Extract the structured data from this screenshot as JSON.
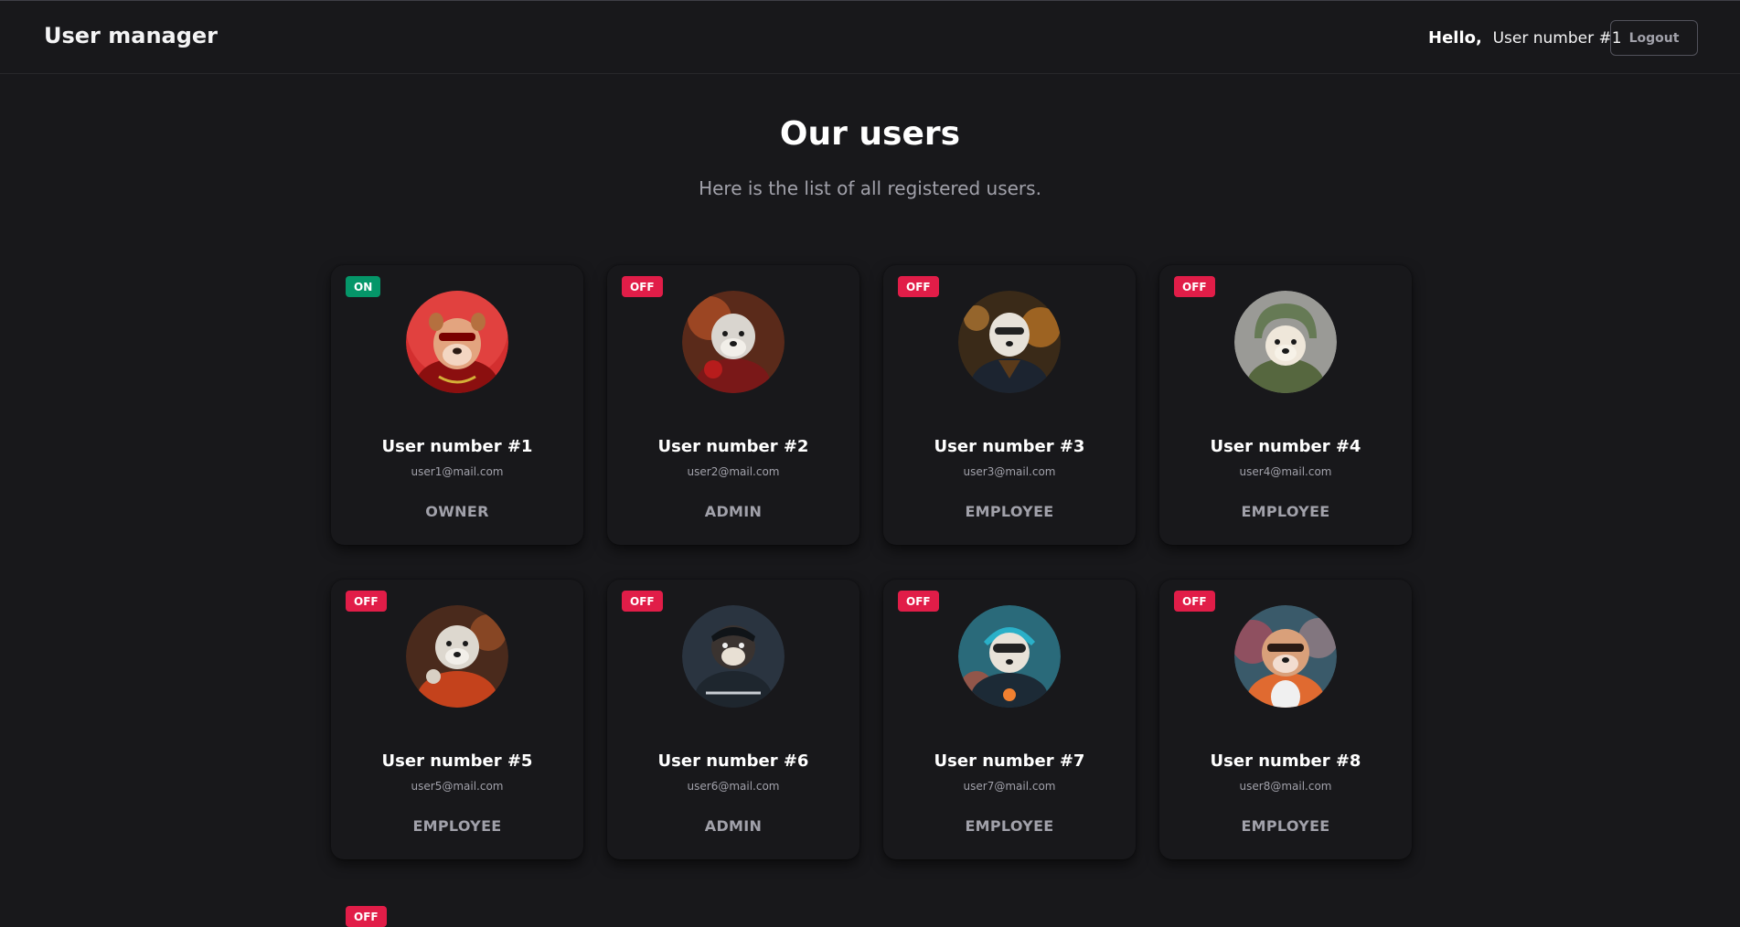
{
  "header": {
    "brand": "User manager",
    "hello": "Hello,",
    "current_user": "User number #1",
    "logout_label": "Logout"
  },
  "page": {
    "title": "Our users",
    "subtitle": "Here is the list of all registered users."
  },
  "colors": {
    "background": "#18181b",
    "on_badge": "#059669",
    "off_badge": "#e11d48",
    "muted_text": "#a1a1aa"
  },
  "users": [
    {
      "status": "ON",
      "name": "User number #1",
      "email": "user1@mail.com",
      "role": "OWNER",
      "avatar": "dog-avatar-red-sunglasses"
    },
    {
      "status": "OFF",
      "name": "User number #2",
      "email": "user2@mail.com",
      "role": "ADMIN",
      "avatar": "dog-avatar-boxing-gloves"
    },
    {
      "status": "OFF",
      "name": "User number #3",
      "email": "user3@mail.com",
      "role": "EMPLOYEE",
      "avatar": "dog-avatar-leather-jacket"
    },
    {
      "status": "OFF",
      "name": "User number #4",
      "email": "user4@mail.com",
      "role": "EMPLOYEE",
      "avatar": "dog-avatar-helmet"
    },
    {
      "status": "OFF",
      "name": "User number #5",
      "email": "user5@mail.com",
      "role": "EMPLOYEE",
      "avatar": "dog-avatar-orange-jacket"
    },
    {
      "status": "OFF",
      "name": "User number #6",
      "email": "user6@mail.com",
      "role": "ADMIN",
      "avatar": "dog-avatar-motorcycle-dark"
    },
    {
      "status": "OFF",
      "name": "User number #7",
      "email": "user7@mail.com",
      "role": "EMPLOYEE",
      "avatar": "dog-avatar-motorcycle-goggles"
    },
    {
      "status": "OFF",
      "name": "User number #8",
      "email": "user8@mail.com",
      "role": "EMPLOYEE",
      "avatar": "dog-avatar-bulldog-sunglasses"
    }
  ],
  "partial_next": {
    "status": "OFF"
  }
}
